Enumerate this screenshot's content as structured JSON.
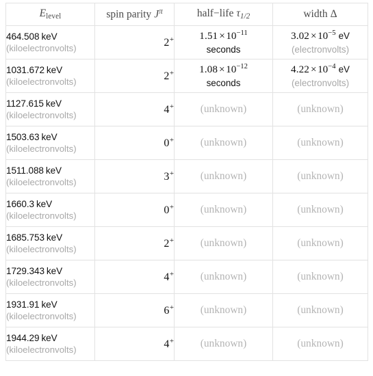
{
  "table": {
    "columns": [
      {
        "key": "energy",
        "label_text": "E_level",
        "var": "E",
        "sub": "level",
        "align": "center"
      },
      {
        "key": "spin",
        "label_text": "spin parity J^π",
        "prefix": "spin parity",
        "var": "J",
        "sup": "π",
        "align": "center"
      },
      {
        "key": "halflife",
        "label_text": "half−life τ_1/2",
        "prefix": "half−life",
        "var": "τ",
        "sub": "1/2",
        "align": "center"
      },
      {
        "key": "width",
        "label_text": "width Δ",
        "prefix": "width",
        "var": "Δ",
        "align": "center"
      }
    ],
    "rows": [
      {
        "energy_value": "464.508",
        "energy_unit": "keV",
        "energy_sub": "(kiloelectronvolts)",
        "spin_value": "2",
        "spin_parity": "+",
        "halflife_mantissa": "1.51",
        "halflife_times": "×",
        "halflife_base": "10",
        "halflife_exponent": "−11",
        "halflife_unit": "seconds",
        "halflife_unknown": "",
        "width_mantissa": "3.02",
        "width_times": "×",
        "width_base": "10",
        "width_exponent": "−5",
        "width_inline_unit": "eV",
        "width_sub": "(electronvolts)",
        "width_unknown": ""
      },
      {
        "energy_value": "1031.672",
        "energy_unit": "keV",
        "energy_sub": "(kiloelectronvolts)",
        "spin_value": "2",
        "spin_parity": "+",
        "halflife_mantissa": "1.08",
        "halflife_times": "×",
        "halflife_base": "10",
        "halflife_exponent": "−12",
        "halflife_unit": "seconds",
        "halflife_unknown": "",
        "width_mantissa": "4.22",
        "width_times": "×",
        "width_base": "10",
        "width_exponent": "−4",
        "width_inline_unit": "eV",
        "width_sub": "(electronvolts)",
        "width_unknown": ""
      },
      {
        "energy_value": "1127.615",
        "energy_unit": "keV",
        "energy_sub": "(kiloelectronvolts)",
        "spin_value": "4",
        "spin_parity": "+",
        "halflife_unknown": "(unknown)",
        "width_unknown": "(unknown)"
      },
      {
        "energy_value": "1503.63",
        "energy_unit": "keV",
        "energy_sub": "(kiloelectronvolts)",
        "spin_value": "0",
        "spin_parity": "+",
        "halflife_unknown": "(unknown)",
        "width_unknown": "(unknown)"
      },
      {
        "energy_value": "1511.088",
        "energy_unit": "keV",
        "energy_sub": "(kiloelectronvolts)",
        "spin_value": "3",
        "spin_parity": "+",
        "halflife_unknown": "(unknown)",
        "width_unknown": "(unknown)"
      },
      {
        "energy_value": "1660.3",
        "energy_unit": "keV",
        "energy_sub": "(kiloelectronvolts)",
        "spin_value": "0",
        "spin_parity": "+",
        "halflife_unknown": "(unknown)",
        "width_unknown": "(unknown)"
      },
      {
        "energy_value": "1685.753",
        "energy_unit": "keV",
        "energy_sub": "(kiloelectronvolts)",
        "spin_value": "2",
        "spin_parity": "+",
        "halflife_unknown": "(unknown)",
        "width_unknown": "(unknown)"
      },
      {
        "energy_value": "1729.343",
        "energy_unit": "keV",
        "energy_sub": "(kiloelectronvolts)",
        "spin_value": "4",
        "spin_parity": "+",
        "halflife_unknown": "(unknown)",
        "width_unknown": "(unknown)"
      },
      {
        "energy_value": "1931.91",
        "energy_unit": "keV",
        "energy_sub": "(kiloelectronvolts)",
        "spin_value": "6",
        "spin_parity": "+",
        "halflife_unknown": "(unknown)",
        "width_unknown": "(unknown)"
      },
      {
        "energy_value": "1944.29",
        "energy_unit": "keV",
        "energy_sub": "(kiloelectronvolts)",
        "spin_value": "4",
        "spin_parity": "+",
        "halflife_unknown": "(unknown)",
        "width_unknown": "(unknown)"
      }
    ]
  },
  "colors": {
    "border": "#e2e2e2",
    "text_primary": "#111111",
    "text_muted": "#a8a8a8",
    "text_unknown": "#b4b4b4",
    "header_text": "#4a4a4a",
    "background": "#ffffff"
  }
}
